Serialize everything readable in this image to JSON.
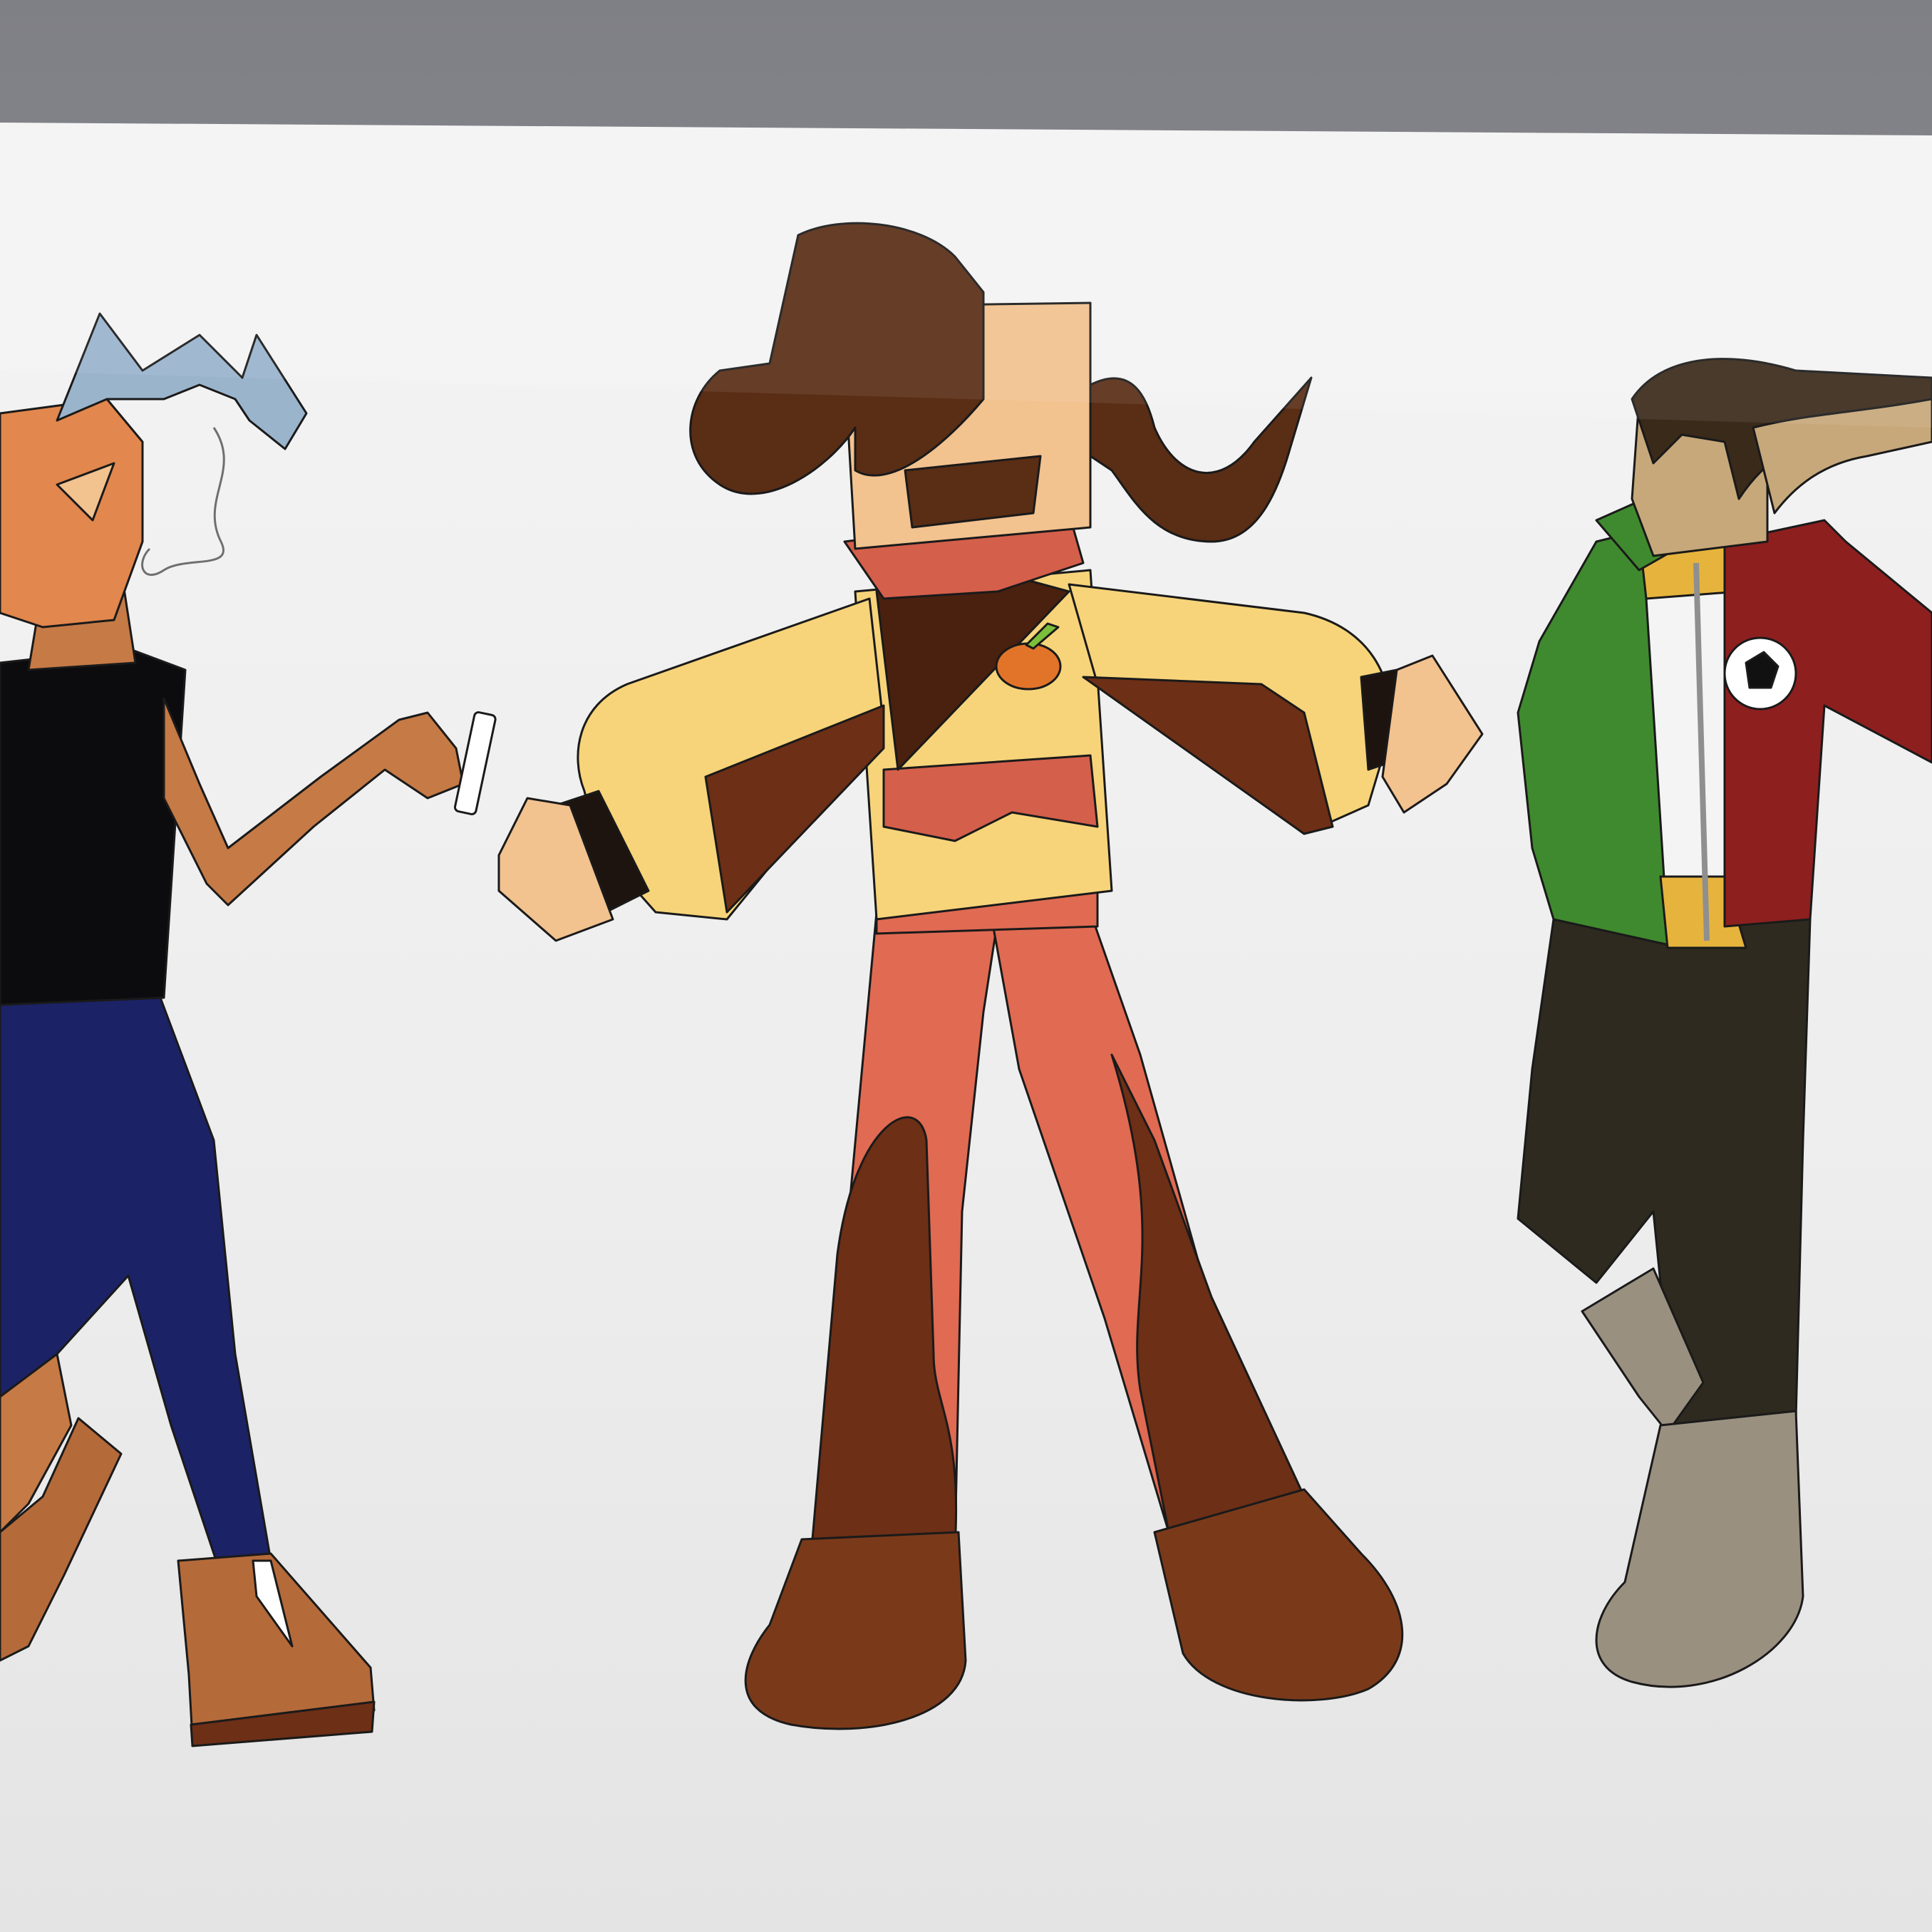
{
  "scene": {
    "kind": "photo-of-monitor",
    "background_top": "#8f9094",
    "screen_color": "#eeeeee",
    "characters": [
      {
        "id": "left",
        "palette": {
          "head": "#e2874d",
          "shirt": "#0c0c0e",
          "jeans": "#1c2266",
          "skin": "#c67a45",
          "boots": "#b56a3a",
          "hair": "#9ab4cc"
        }
      },
      {
        "id": "center",
        "palette": {
          "hair": "#5a2d15",
          "skin": "#f2c28f",
          "sweater": "#f7d47a",
          "scarf": "#d45f4b",
          "pants": "#e06a52",
          "brown": "#6d2f16",
          "boots": "#7a3a1a"
        }
      },
      {
        "id": "right",
        "palette": {
          "green": "#3f8a2e",
          "red": "#8e1f1f",
          "white": "#f4f4f4",
          "yellow": "#e6b43d",
          "hair_tan": "#c7a87a",
          "pants": "#2f2a1f",
          "boots": "#9a9080"
        }
      }
    ]
  }
}
